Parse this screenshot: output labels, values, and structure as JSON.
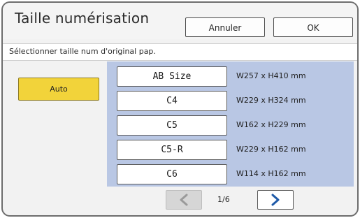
{
  "dialog": {
    "title": "Taille numérisation",
    "cancel_label": "Annuler",
    "ok_label": "OK"
  },
  "instruction": "Sélectionner taille num d'original pap.",
  "auto_label": "Auto",
  "sizes": [
    {
      "label": "AB Size",
      "dims": "W257 x H410 mm"
    },
    {
      "label": "C4",
      "dims": "W229 x H324 mm"
    },
    {
      "label": "C5",
      "dims": "W162 x H229 mm"
    },
    {
      "label": "C5-R",
      "dims": "W229 x H162 mm"
    },
    {
      "label": "C6",
      "dims": "W114 x H162 mm"
    }
  ],
  "pager": {
    "indicator": "1/6",
    "prev_icon": "chevron-left-icon",
    "next_icon": "chevron-right-icon"
  },
  "colors": {
    "auto_bg": "#f2d33a",
    "panel_bg": "#b9c7e4",
    "next_arrow": "#1e5aa8",
    "prev_arrow_disabled": "#9a9a9a"
  }
}
